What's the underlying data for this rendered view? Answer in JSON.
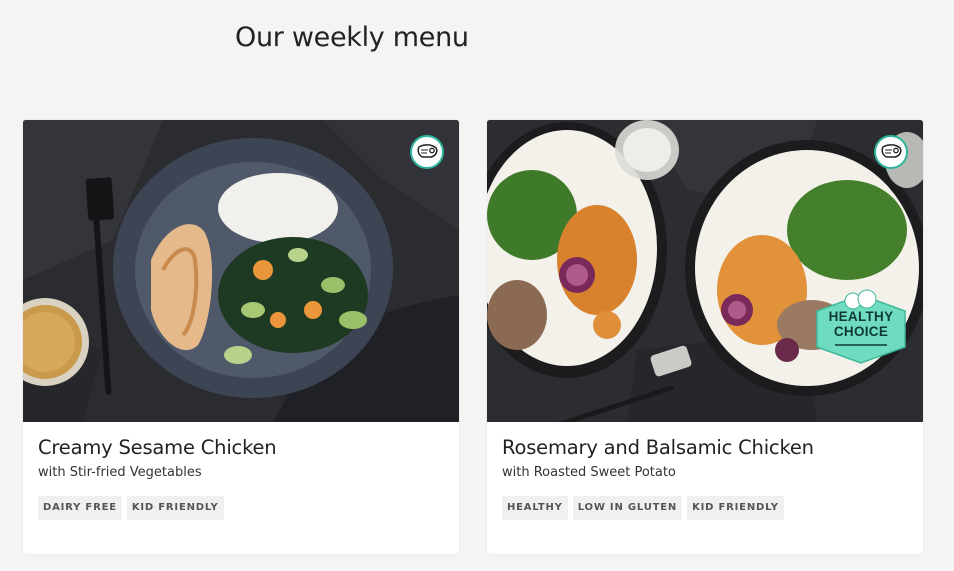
{
  "page": {
    "title": "Our weekly menu"
  },
  "recipes": [
    {
      "name": "Creamy Sesame Chicken",
      "subtitle": "with Stir-fried Vegetables",
      "tags": [
        "DAIRY FREE",
        "KID FRIENDLY"
      ],
      "icon": "meat-icon"
    },
    {
      "name": "Rosemary and Balsamic Chicken",
      "subtitle": "with Roasted Sweet Potato",
      "tags": [
        "HEALTHY",
        "LOW IN GLUTEN",
        "KID FRIENDLY"
      ],
      "icon": "meat-icon",
      "badge": {
        "line1": "HEALTHY",
        "line2": "CHOICE",
        "color": "#6fdcc0"
      }
    }
  ],
  "colors": {
    "background": "#f4f4f4",
    "accent": "#2db59c",
    "tag_bg": "#f0f0f0"
  }
}
